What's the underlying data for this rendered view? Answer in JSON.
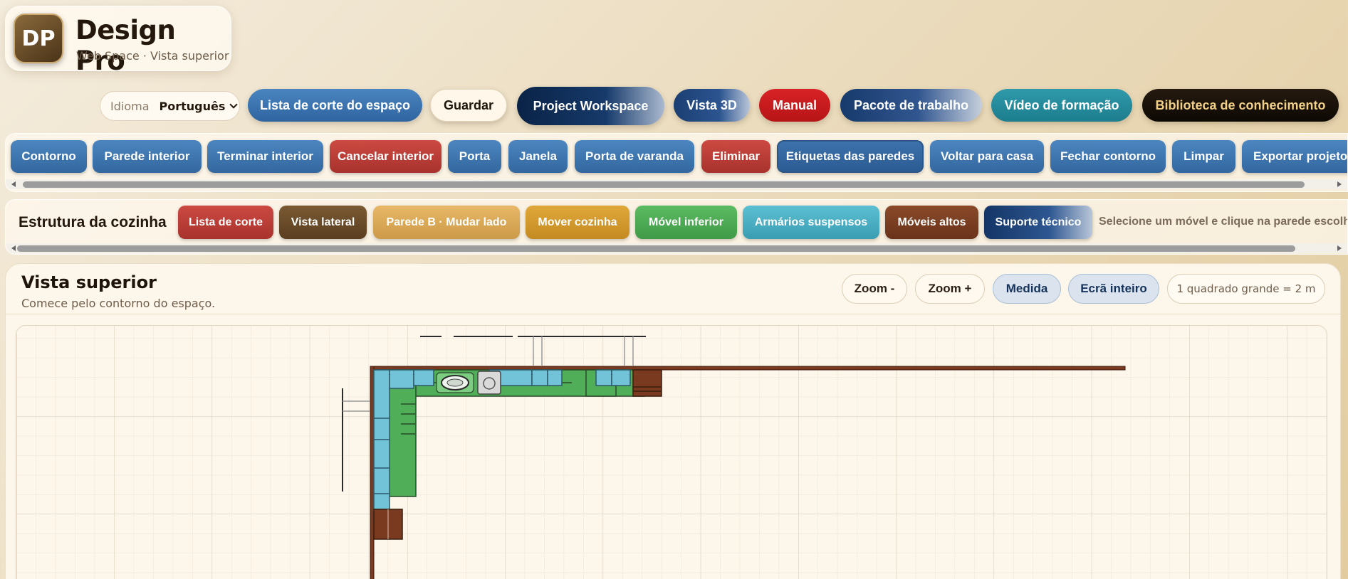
{
  "app": {
    "logo_initials": "DP",
    "title": "Design Pro",
    "subtitle": "Web Space · Vista superior"
  },
  "language": {
    "label": "Idioma",
    "value": "Português"
  },
  "top_buttons": [
    {
      "label": "Lista de corte do espaço"
    },
    {
      "label": "Guardar"
    },
    {
      "label": "Project Workspace"
    },
    {
      "label": "Vista 3D"
    },
    {
      "label": "Manual"
    },
    {
      "label": "Pacote de trabalho"
    },
    {
      "label": "Vídeo de formação"
    },
    {
      "label": "Biblioteca de conhecimento"
    }
  ],
  "toolbar": [
    {
      "label": "Contorno"
    },
    {
      "label": "Parede interior"
    },
    {
      "label": "Terminar interior"
    },
    {
      "label": "Cancelar interior"
    },
    {
      "label": "Porta"
    },
    {
      "label": "Janela"
    },
    {
      "label": "Porta de varanda"
    },
    {
      "label": "Eliminar"
    },
    {
      "label": "Etiquetas das paredes"
    },
    {
      "label": "Voltar para casa"
    },
    {
      "label": "Fechar contorno"
    },
    {
      "label": "Limpar"
    },
    {
      "label": "Exportar projeto"
    }
  ],
  "kitchen": {
    "title": "Estrutura da cozinha",
    "buttons": [
      {
        "label": "Lista de corte"
      },
      {
        "label": "Vista lateral"
      },
      {
        "label": "Parede B · Mudar lado"
      },
      {
        "label": "Mover cozinha"
      },
      {
        "label": "Móvel inferior"
      },
      {
        "label": "Armários suspensos"
      },
      {
        "label": "Móveis altos"
      },
      {
        "label": "Suporte técnico"
      }
    ],
    "hint": "Selecione um móvel e clique na parede escolhida"
  },
  "view": {
    "title": "Vista superior",
    "subtitle": "Comece pelo contorno do espaço.",
    "zoom_out": "Zoom -",
    "zoom_in": "Zoom +",
    "measure": "Medida",
    "fullscreen": "Ecrã inteiro",
    "scale": "1 quadrado grande = 2 m"
  },
  "colors": {
    "blue": "#3a72ad",
    "red": "#c03a38",
    "brown": "#7a3d22",
    "green": "#4fae57",
    "cyan": "#6cc2d8",
    "navy": "#0e2a4f",
    "gold": "#f1cf86"
  }
}
